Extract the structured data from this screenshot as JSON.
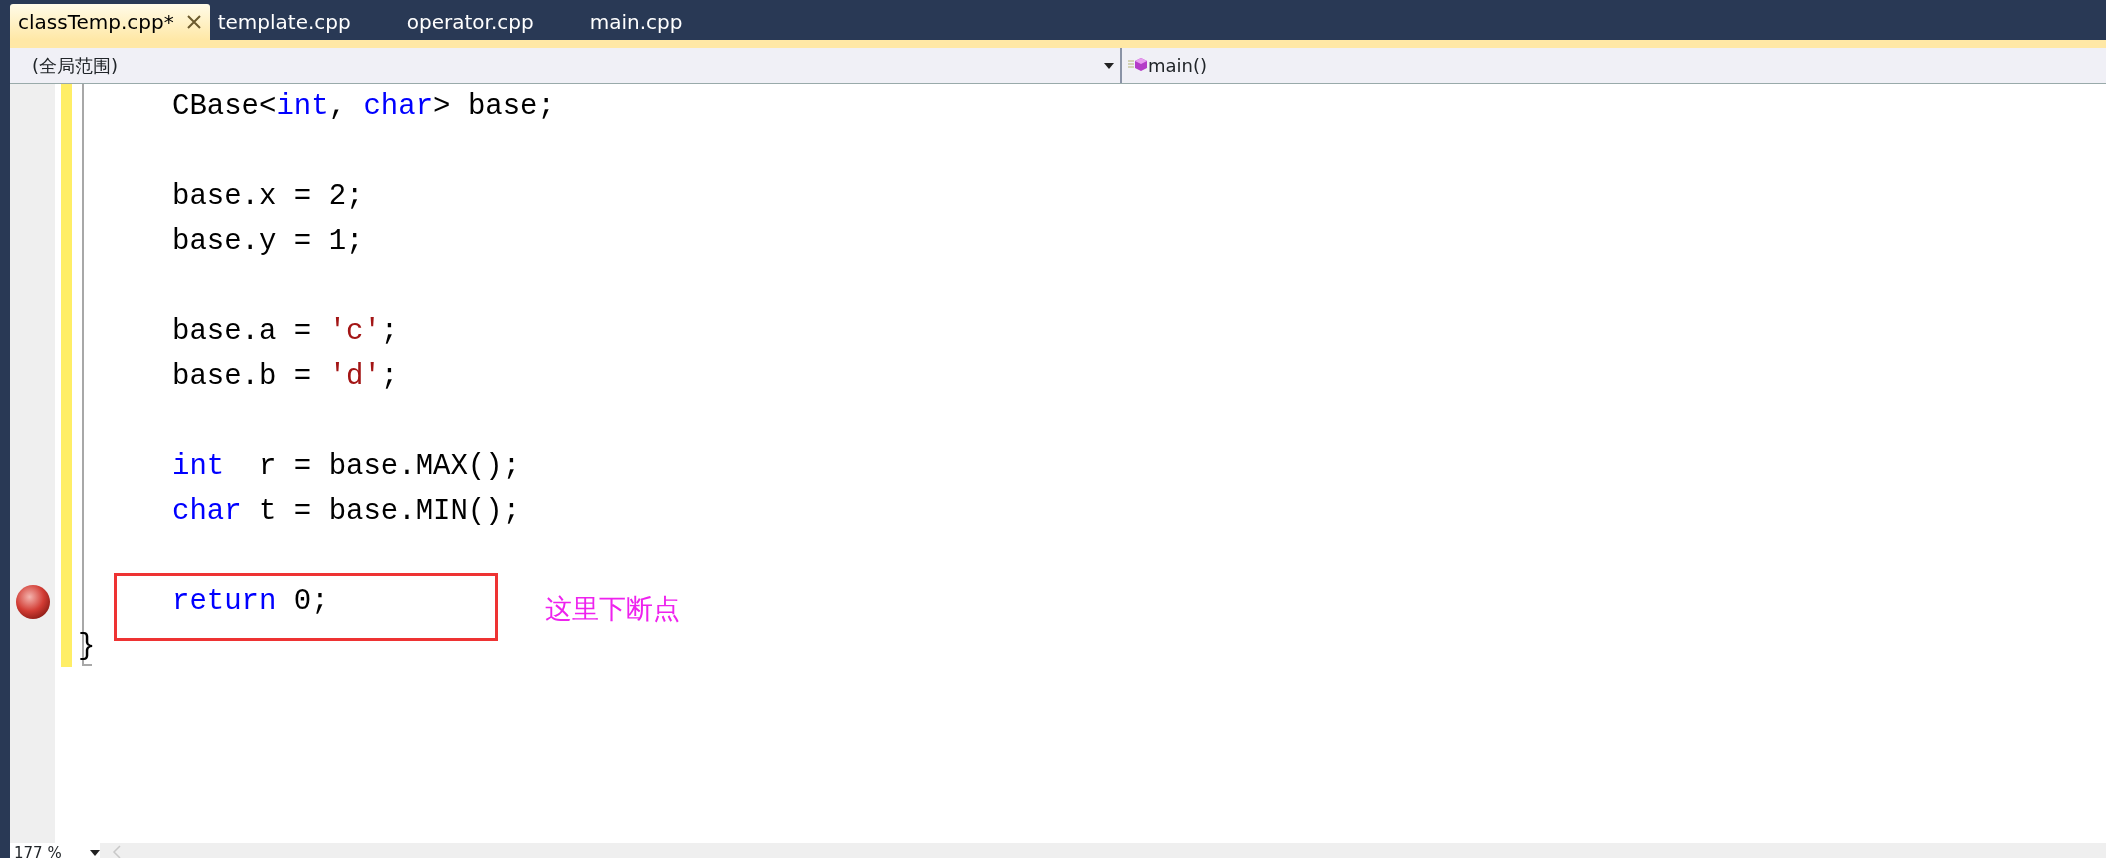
{
  "tabs": [
    {
      "label": "classTemp.cpp*",
      "selected": true,
      "closable": true
    },
    {
      "label": "template.cpp",
      "selected": false,
      "closable": false
    },
    {
      "label": "operator.cpp",
      "selected": false,
      "closable": false
    },
    {
      "label": "main.cpp",
      "selected": false,
      "closable": false
    }
  ],
  "scope_dropdown": {
    "value": "(全局范围)"
  },
  "member_dropdown": {
    "value": "main()"
  },
  "code_lines": [
    {
      "kind": "code",
      "breakpoint": false,
      "boxed": false,
      "tokens": [
        {
          "kind": "plain",
          "text": "CBase<"
        },
        {
          "kind": "keyword",
          "text": "int"
        },
        {
          "kind": "plain",
          "text": ", "
        },
        {
          "kind": "keyword",
          "text": "char"
        },
        {
          "kind": "plain",
          "text": "> base;"
        }
      ]
    },
    {
      "kind": "blank",
      "breakpoint": false,
      "boxed": false
    },
    {
      "kind": "code",
      "breakpoint": false,
      "boxed": false,
      "tokens": [
        {
          "kind": "plain",
          "text": "base.x = 2;"
        }
      ]
    },
    {
      "kind": "code",
      "breakpoint": false,
      "boxed": false,
      "tokens": [
        {
          "kind": "plain",
          "text": "base.y = 1;"
        }
      ]
    },
    {
      "kind": "blank",
      "breakpoint": false,
      "boxed": false
    },
    {
      "kind": "code",
      "breakpoint": false,
      "boxed": false,
      "tokens": [
        {
          "kind": "plain",
          "text": "base.a = "
        },
        {
          "kind": "string",
          "text": "'c'"
        },
        {
          "kind": "plain",
          "text": ";"
        }
      ]
    },
    {
      "kind": "code",
      "breakpoint": false,
      "boxed": false,
      "tokens": [
        {
          "kind": "plain",
          "text": "base.b = "
        },
        {
          "kind": "string",
          "text": "'d'"
        },
        {
          "kind": "plain",
          "text": ";"
        }
      ]
    },
    {
      "kind": "blank",
      "breakpoint": false,
      "boxed": false
    },
    {
      "kind": "code",
      "breakpoint": false,
      "boxed": false,
      "tokens": [
        {
          "kind": "keyword",
          "text": "int"
        },
        {
          "kind": "plain",
          "text": "  r = base.MAX();"
        }
      ]
    },
    {
      "kind": "code",
      "breakpoint": false,
      "boxed": false,
      "tokens": [
        {
          "kind": "keyword",
          "text": "char"
        },
        {
          "kind": "plain",
          "text": " t = base.MIN();"
        }
      ]
    },
    {
      "kind": "blank",
      "breakpoint": false,
      "boxed": false
    },
    {
      "kind": "code",
      "breakpoint": true,
      "boxed": true,
      "tokens": [
        {
          "kind": "keyword",
          "text": "return"
        },
        {
          "kind": "plain",
          "text": " 0;"
        }
      ]
    },
    {
      "kind": "close",
      "breakpoint": false,
      "boxed": false,
      "tokens": [
        {
          "kind": "plain",
          "text": "}"
        }
      ]
    }
  ],
  "annotation": {
    "text": "这里下断点"
  },
  "status_bar": {
    "zoom": "177 %"
  }
}
